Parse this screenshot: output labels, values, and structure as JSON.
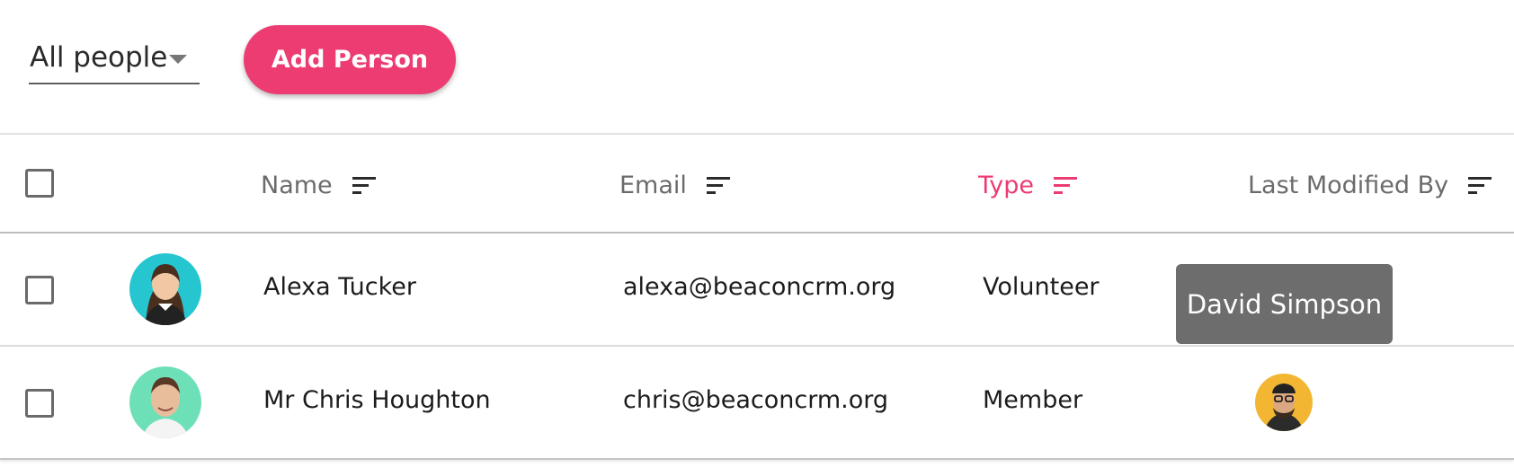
{
  "toolbar": {
    "filter": {
      "selected": "All people",
      "icon": "chevron-down-icon"
    },
    "add_button_label": "Add Person"
  },
  "table": {
    "columns": [
      {
        "label": "Name",
        "sortable": true,
        "active": false
      },
      {
        "label": "Email",
        "sortable": true,
        "active": false
      },
      {
        "label": "Type",
        "sortable": true,
        "active": true
      },
      {
        "label": "Last Modified By",
        "sortable": true,
        "active": false
      }
    ],
    "rows": [
      {
        "name": "Alexa Tucker",
        "email": "alexa@beaconcrm.org",
        "type": "Volunteer",
        "avatar_bg": "#26c6d0",
        "modified_by": "David Simpson"
      },
      {
        "name": "Mr Chris Houghton",
        "email": "chris@beaconcrm.org",
        "type": "Member",
        "avatar_bg": "#6ee0b8",
        "modified_by": "David Simpson"
      }
    ]
  },
  "tooltip": {
    "text": "David Simpson"
  },
  "colors": {
    "accent": "#ec3c72",
    "tooltip_bg": "#6d6d6d",
    "modifier_avatar_bg": "#f2b632"
  }
}
